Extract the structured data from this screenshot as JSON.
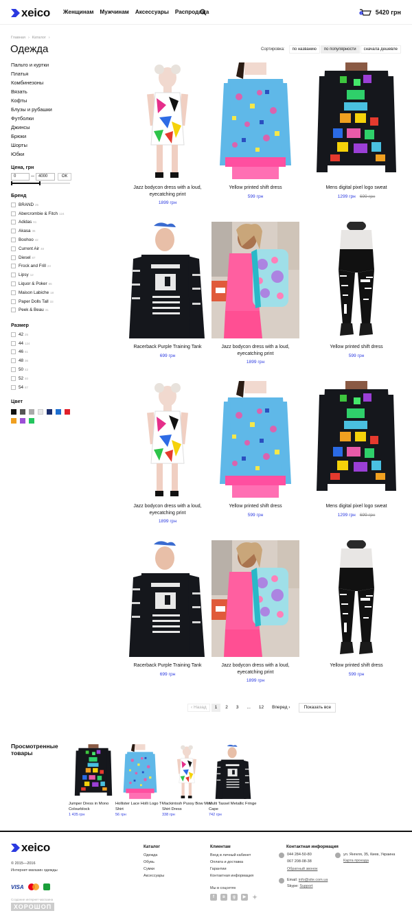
{
  "header": {
    "logo": "xeico",
    "nav": [
      "Женщинам",
      "Мужчинам",
      "Аксессуары",
      "Распродажа"
    ],
    "cart_total": "5420 грн",
    "cart_count": "2"
  },
  "breadcrumbs": [
    "Главная",
    "Каталог"
  ],
  "page_title": "Одежда",
  "categories": [
    "Пальто и куртки",
    "Платья",
    "Комбинезоны",
    "Вязать",
    "Кофты",
    "Блузы и рубашки",
    "Футболки",
    "Джинсы",
    "Брюки",
    "Шорты",
    "Юбки"
  ],
  "price_filter": {
    "title": "Цена, грн",
    "min": "0",
    "max": "4000",
    "ok": "ОК",
    "range_fraction": [
      0,
      0.5
    ]
  },
  "brand_filter": {
    "title": "Бренд",
    "items": [
      {
        "label": "BRAND",
        "count": "25"
      },
      {
        "label": "Abercrombie & Fitch",
        "count": "124"
      },
      {
        "label": "Adidas",
        "count": "61"
      },
      {
        "label": "Akasa",
        "count": "36"
      },
      {
        "label": "Boohoo",
        "count": "42"
      },
      {
        "label": "Current Air",
        "count": "40"
      },
      {
        "label": "Diesel",
        "count": "87"
      },
      {
        "label": "Frock and Frill",
        "count": "24"
      },
      {
        "label": "Lipsy",
        "count": "12"
      },
      {
        "label": "Liquor & Poker",
        "count": "65"
      },
      {
        "label": "Maison Labiche",
        "count": "18"
      },
      {
        "label": "Paper Dolls Tall",
        "count": "33"
      },
      {
        "label": "Peek & Beau",
        "count": "31"
      }
    ]
  },
  "size_filter": {
    "title": "Размер",
    "items": [
      {
        "label": "42",
        "count": "25"
      },
      {
        "label": "44",
        "count": "124"
      },
      {
        "label": "46",
        "count": "61"
      },
      {
        "label": "48",
        "count": "36"
      },
      {
        "label": "50",
        "count": "42"
      },
      {
        "label": "52",
        "count": "40"
      },
      {
        "label": "54",
        "count": "87"
      }
    ]
  },
  "color_filter": {
    "title": "Цвет",
    "colors": [
      "#111111",
      "#555555",
      "#aaaaaa",
      "#e8e8e8",
      "#1c2f6e",
      "#1d6fd1",
      "#e0202a",
      "#f0a020",
      "#9b4fd6",
      "#23c55e"
    ]
  },
  "sort": {
    "label": "Сортировка:",
    "options": [
      "по названию",
      "по популярности",
      "сначала дешевле"
    ],
    "active": "по популярности"
  },
  "products": [
    {
      "name": "Jazz bodycon dress with a loud, eyecatching print",
      "price": "1899 грн",
      "old_price": "",
      "img": "dress"
    },
    {
      "name": "Yellow printed shift dress",
      "price": "599 грн",
      "old_price": "",
      "img": "sweat"
    },
    {
      "name": "Mens digital pixel logo sweat",
      "price": "1299 грн",
      "old_price": "699 грн",
      "img": "pixel"
    },
    {
      "name": "Racerback Purple Training Tank",
      "price": "699 грн",
      "old_price": "",
      "img": "tank"
    },
    {
      "name": "Jazz bodycon dress with a loud, eyecatching print",
      "price": "1899 грн",
      "old_price": "",
      "img": "backpack"
    },
    {
      "name": "Yellow printed shift dress",
      "price": "599 грн",
      "old_price": "",
      "img": "leggings"
    },
    {
      "name": "Jazz bodycon dress with a loud, eyecatching print",
      "price": "1899 грн",
      "old_price": "",
      "img": "dress"
    },
    {
      "name": "Yellow printed shift dress",
      "price": "599 грн",
      "old_price": "",
      "img": "sweat"
    },
    {
      "name": "Mens digital pixel logo sweat",
      "price": "1299 грн",
      "old_price": "699 грн",
      "img": "pixel"
    },
    {
      "name": "Racerback Purple Training Tank",
      "price": "699 грн",
      "old_price": "",
      "img": "tank"
    },
    {
      "name": "Jazz bodycon dress with a loud, eyecatching print",
      "price": "1899 грн",
      "old_price": "",
      "img": "backpack"
    },
    {
      "name": "Yellow printed shift dress",
      "price": "599 грн",
      "old_price": "",
      "img": "leggings"
    }
  ],
  "pagination": {
    "prev": "Назад",
    "pages": [
      "1",
      "2",
      "3",
      "...",
      "12"
    ],
    "current": "1",
    "next": "Вперед",
    "show_all": "Показать все"
  },
  "viewed": {
    "title": "Просмотренные товары",
    "items": [
      {
        "name": "Jumper Dress in Mono Colourblock",
        "price": "1 435 грн",
        "img": "pixel"
      },
      {
        "name": "Hollister Lace Holli Logo T-Shirt",
        "price": "56 грн",
        "img": "sweat"
      },
      {
        "name": "Mackintosh Pussy Bow Mini Shirt Dress",
        "price": "338 грн",
        "img": "dress"
      },
      {
        "name": "Multi Tassel Metallic Fringe Cape",
        "price": "742 грн",
        "img": "tank"
      }
    ]
  },
  "footer": {
    "logo": "xeico",
    "copyright": "© 2015—2016",
    "tagline": "Интернет-магазин одежды",
    "payments": [
      "VISA",
      "MasterCard",
      "Приват"
    ],
    "made_by_label": "Создание интернет-магазина",
    "made_by": "ХОРОШОП",
    "catalog": {
      "title": "Каталог",
      "links": [
        "Одежда",
        "Обувь",
        "Сумки",
        "Аксессуары"
      ]
    },
    "clients": {
      "title": "Клиентам",
      "links": [
        "Вход в личный кабинет",
        "Оплата и доставка",
        "Гарантии",
        "Контактная информация"
      ],
      "social_label": "Мы в соцсетях"
    },
    "contacts": {
      "title": "Контактная информация",
      "phones": [
        "044 284-50-80",
        "067 208-08-38"
      ],
      "callback": "Обратный звонок",
      "address": "ул. Янгеля, 35, Киев, Украина",
      "map_link": "Карта проезда",
      "email_label": "Email:",
      "email": "info@site.com.ua",
      "skype_label": "Skype:",
      "skype": "Support"
    }
  }
}
